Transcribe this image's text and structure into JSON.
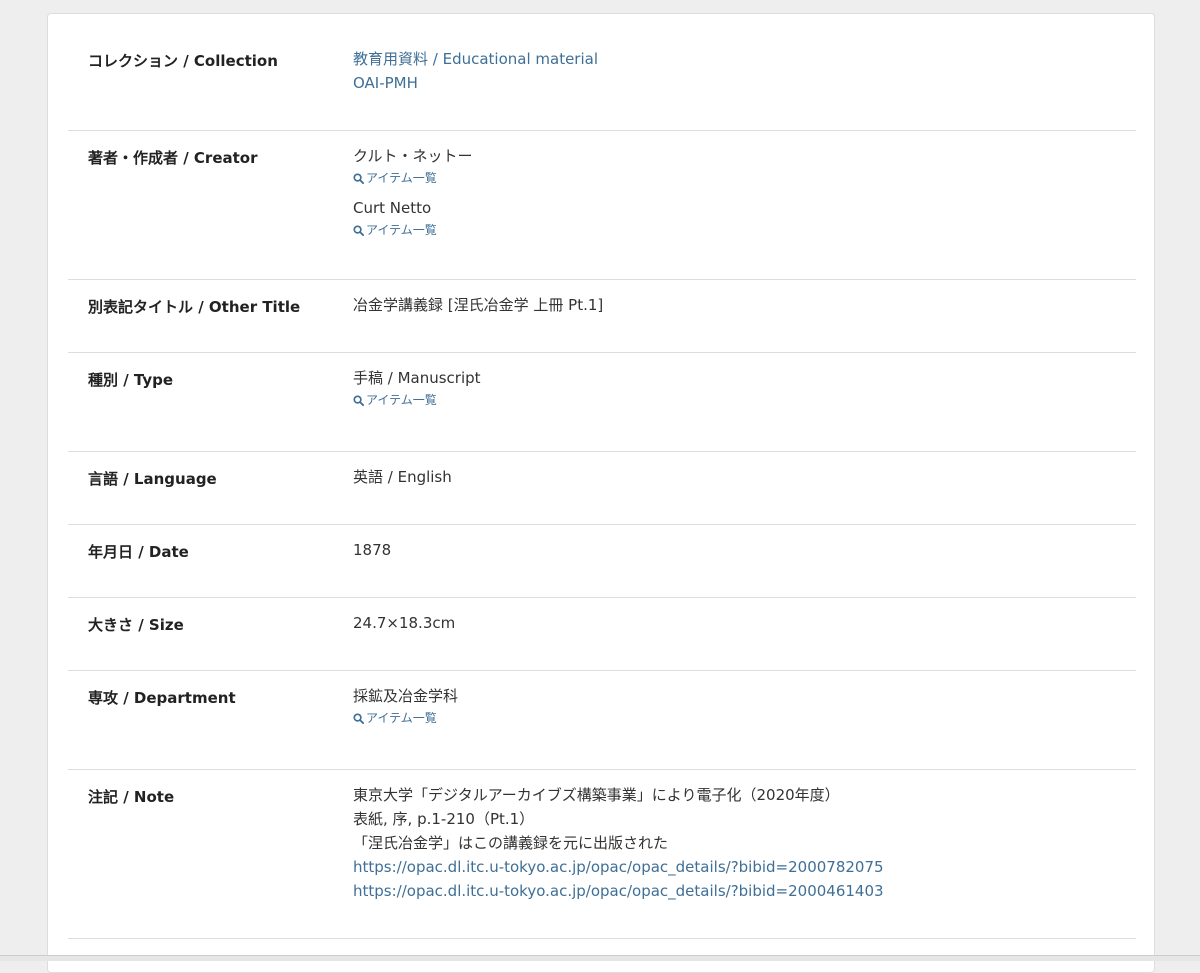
{
  "rows": [
    {
      "label": "コレクション / Collection",
      "values": [
        {
          "text": "教育用資料 / Educational material",
          "link": true
        },
        {
          "text": "OAI-PMH",
          "link": true
        }
      ]
    },
    {
      "label": "著者・作成者 / Creator",
      "values": [
        {
          "text": "クルト・ネットー",
          "sub": "アイテム一覧"
        },
        {
          "text": "Curt Netto",
          "sub": "アイテム一覧"
        }
      ]
    },
    {
      "label": "別表記タイトル / Other Title",
      "values": [
        {
          "text": "冶金学講義録 [涅氏冶金学 上冊 Pt.1]"
        }
      ]
    },
    {
      "label": "種別 / Type",
      "values": [
        {
          "text": "手稿 / Manuscript",
          "sub": "アイテム一覧"
        }
      ]
    },
    {
      "label": "言語 / Language",
      "values": [
        {
          "text": "英語 / English"
        }
      ]
    },
    {
      "label": "年月日 / Date",
      "values": [
        {
          "text": "1878"
        }
      ]
    },
    {
      "label": "大きさ / Size",
      "values": [
        {
          "text": "24.7×18.3cm"
        }
      ]
    },
    {
      "label": "専攻 / Department",
      "values": [
        {
          "text": "採鉱及冶金学科",
          "sub": "アイテム一覧"
        }
      ]
    },
    {
      "label": "注記 / Note",
      "values": [
        {
          "text": "東京大学「デジタルアーカイブズ構築事業」により電子化（2020年度）"
        },
        {
          "text": "表紙, 序, p.1-210（Pt.1）"
        },
        {
          "text": "「涅氏冶金学」はこの講義録を元に出版された"
        },
        {
          "text": "https://opac.dl.itc.u-tokyo.ac.jp/opac/opac_details/?bibid=2000782075",
          "link": true
        },
        {
          "text": "https://opac.dl.itc.u-tokyo.ac.jp/opac/opac_details/?bibid=2000461403",
          "link": true
        }
      ]
    }
  ]
}
